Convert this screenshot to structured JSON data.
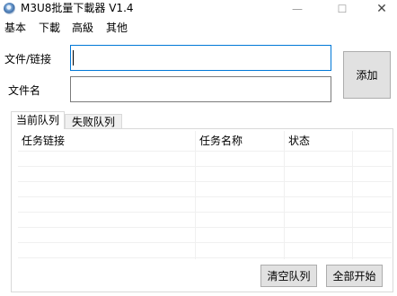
{
  "window": {
    "title": "M3U8批量下載器 V1.4",
    "minimize_glyph": "—",
    "maximize_glyph": "☐",
    "close_glyph": "✕"
  },
  "menu": {
    "items": [
      {
        "label": "基本"
      },
      {
        "label": "下載"
      },
      {
        "label": "高級"
      },
      {
        "label": "其他"
      }
    ]
  },
  "form": {
    "file_link_label": "文件/链接",
    "file_link_value": "",
    "file_name_label": "文件名",
    "file_name_value": "",
    "add_button_label": "添加"
  },
  "tabs": [
    {
      "label": "当前队列",
      "active": true
    },
    {
      "label": "失败队列",
      "active": false
    }
  ],
  "task_table": {
    "columns": [
      {
        "label": "任务链接"
      },
      {
        "label": "任务名称"
      },
      {
        "label": "状态"
      },
      {
        "label": ""
      }
    ],
    "rows": []
  },
  "actions": {
    "clear_queue_label": "清空队列",
    "start_all_label": "全部开始"
  },
  "colors": {
    "focus_border": "#0078d7",
    "button_face": "#e1e1e1",
    "button_border": "#adadad",
    "grid_line": "#f0f0f0",
    "tab_border": "#d9d9d9"
  },
  "icons": {
    "app": "disc-icon"
  }
}
